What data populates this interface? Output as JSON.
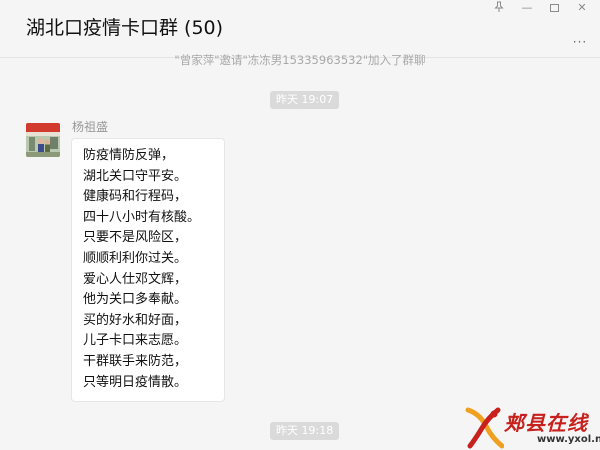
{
  "window": {
    "title": "湖北口疫情卡口群 (50)",
    "controls": {
      "pin_icon": "pin-icon",
      "minimize_label": "—",
      "close_label": "✕",
      "more_label": "···"
    }
  },
  "messages": {
    "system_notice": "\"曾家萍\"邀请\"冻冻男15335963532\"加入了群聊",
    "timestamps": [
      "昨天 19:07",
      "昨天 19:18"
    ],
    "chat": {
      "sender": "杨祖盛",
      "lines": [
        "防疫情防反弹，",
        "湖北关口守平安。",
        "健康码和行程码，",
        "四十八小时有核酸。",
        "只要不是风险区，",
        "顺顺利利你过关。",
        "爱心人仕邓文辉，",
        "他为关口多奉献。",
        "买的好水和好面，",
        "儿子卡口来志愿。",
        "干群联手来防范，",
        "只等明日疫情散。"
      ]
    }
  },
  "watermark": {
    "brand": "郏县在线",
    "url": "www.yxol.net",
    "colors": {
      "red": "#c8201c",
      "orange": "#f0a020"
    }
  },
  "colors": {
    "background": "#f5f5f5",
    "bubble": "#ffffff",
    "time_pill": "#dadada",
    "muted_text": "#999999"
  }
}
